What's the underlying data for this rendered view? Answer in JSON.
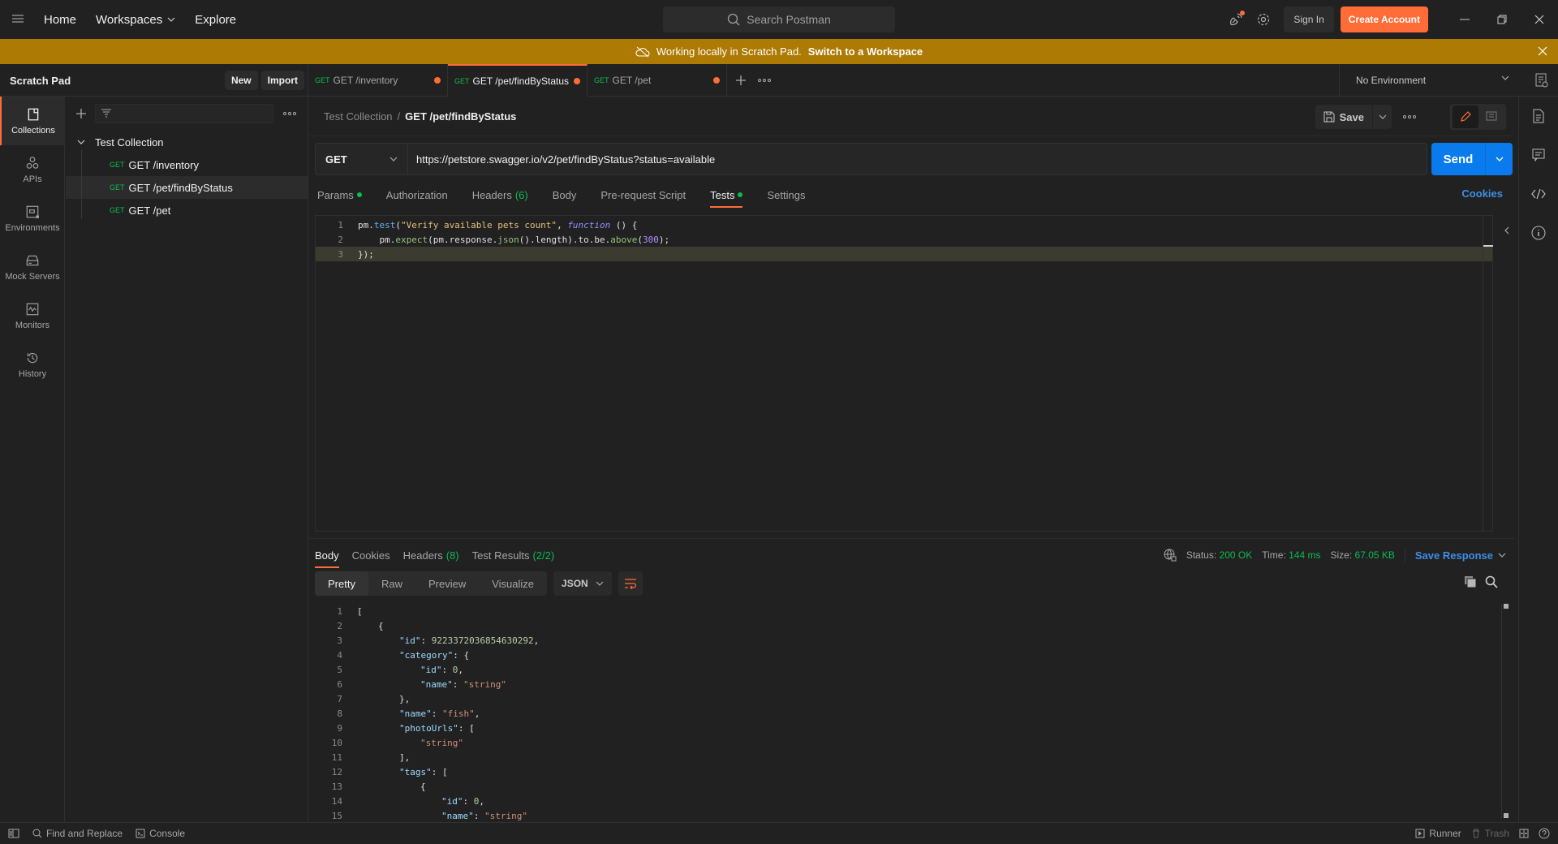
{
  "topbar": {
    "nav": {
      "home": "Home",
      "workspaces": "Workspaces",
      "explore": "Explore"
    },
    "search_placeholder": "Search Postman",
    "sign_in": "Sign In",
    "create_account": "Create Account"
  },
  "banner": {
    "text": "Working locally in Scratch Pad.",
    "link": "Switch to a Workspace"
  },
  "scratch": {
    "title": "Scratch Pad",
    "new": "New",
    "import": "Import"
  },
  "tabs": [
    {
      "method": "GET",
      "label": "GET /inventory",
      "unsaved": true,
      "active": false
    },
    {
      "method": "GET",
      "label": "GET /pet/findByStatus",
      "unsaved": true,
      "active": true
    },
    {
      "method": "GET",
      "label": "GET /pet",
      "unsaved": true,
      "active": false
    }
  ],
  "environment": {
    "selected": "No Environment"
  },
  "iconbar": [
    {
      "label": "Collections",
      "icon": "collections-icon",
      "active": true
    },
    {
      "label": "APIs",
      "icon": "apis-icon"
    },
    {
      "label": "Environments",
      "icon": "environments-icon"
    },
    {
      "label": "Mock Servers",
      "icon": "mock-servers-icon"
    },
    {
      "label": "Monitors",
      "icon": "monitors-icon"
    },
    {
      "label": "History",
      "icon": "history-icon"
    }
  ],
  "sidebar": {
    "collection": "Test Collection",
    "items": [
      {
        "method": "GET",
        "label": "GET /inventory"
      },
      {
        "method": "GET",
        "label": "GET /pet/findByStatus",
        "selected": true
      },
      {
        "method": "GET",
        "label": "GET /pet"
      }
    ]
  },
  "request": {
    "breadcrumb": {
      "parent": "Test Collection",
      "sep": "/",
      "current": "GET /pet/findByStatus"
    },
    "save": "Save",
    "method": "GET",
    "url": "https://petstore.swagger.io/v2/pet/findByStatus?status=available",
    "send": "Send",
    "tabs": [
      {
        "label": "Params",
        "dot": true
      },
      {
        "label": "Authorization"
      },
      {
        "label": "Headers",
        "count": "(6)"
      },
      {
        "label": "Body"
      },
      {
        "label": "Pre-request Script"
      },
      {
        "label": "Tests",
        "dot": true,
        "active": true
      },
      {
        "label": "Settings"
      }
    ],
    "cookies": "Cookies",
    "tests_code": [
      {
        "n": "1",
        "tokens": [
          [
            "",
            "pm."
          ],
          [
            "k-fn",
            "test"
          ],
          [
            "",
            "("
          ],
          [
            "k-str",
            "\"Verify available pets count\""
          ],
          [
            "",
            ", "
          ],
          [
            "k-kw",
            "function"
          ],
          [
            "",
            " () {"
          ]
        ]
      },
      {
        "n": "2",
        "tokens": [
          [
            "",
            "    pm."
          ],
          [
            "k-green",
            "expect"
          ],
          [
            "",
            "(pm.response."
          ],
          [
            "k-green",
            "json"
          ],
          [
            "",
            "().length).to.be."
          ],
          [
            "k-green",
            "above"
          ],
          [
            "",
            "("
          ],
          [
            "k-num",
            "300"
          ],
          [
            "",
            ");"
          ]
        ]
      },
      {
        "n": "3",
        "tokens": [
          [
            "",
            "});"
          ]
        ],
        "current": true
      }
    ]
  },
  "response": {
    "tabs": [
      {
        "label": "Body",
        "active": true
      },
      {
        "label": "Cookies"
      },
      {
        "label": "Headers",
        "count": "(8)"
      },
      {
        "label": "Test Results",
        "count": "(2/2)"
      }
    ],
    "status_label": "Status:",
    "status": "200 OK",
    "time_label": "Time:",
    "time": "144 ms",
    "size_label": "Size:",
    "size": "67.05 KB",
    "save_response": "Save Response",
    "views": [
      "Pretty",
      "Raw",
      "Preview",
      "Visualize"
    ],
    "active_view": "Pretty",
    "format": "JSON",
    "body_lines": [
      {
        "n": "1",
        "indent": 0,
        "tokens": [
          [
            "",
            "["
          ]
        ]
      },
      {
        "n": "2",
        "indent": 1,
        "tokens": [
          [
            "",
            "{"
          ]
        ]
      },
      {
        "n": "3",
        "indent": 2,
        "tokens": [
          [
            "j-key",
            "\"id\""
          ],
          [
            "",
            ": "
          ],
          [
            "j-num",
            "9223372036854630292"
          ],
          [
            "",
            ","
          ]
        ]
      },
      {
        "n": "4",
        "indent": 2,
        "tokens": [
          [
            "j-key",
            "\"category\""
          ],
          [
            "",
            ": {"
          ]
        ]
      },
      {
        "n": "5",
        "indent": 3,
        "tokens": [
          [
            "j-key",
            "\"id\""
          ],
          [
            "",
            ": "
          ],
          [
            "j-num",
            "0"
          ],
          [
            "",
            ","
          ]
        ]
      },
      {
        "n": "6",
        "indent": 3,
        "tokens": [
          [
            "j-key",
            "\"name\""
          ],
          [
            "",
            ": "
          ],
          [
            "j-str",
            "\"string\""
          ]
        ]
      },
      {
        "n": "7",
        "indent": 2,
        "tokens": [
          [
            "",
            "},"
          ]
        ]
      },
      {
        "n": "8",
        "indent": 2,
        "tokens": [
          [
            "j-key",
            "\"name\""
          ],
          [
            "",
            ": "
          ],
          [
            "j-str",
            "\"fish\""
          ],
          [
            "",
            ","
          ]
        ]
      },
      {
        "n": "9",
        "indent": 2,
        "tokens": [
          [
            "j-key",
            "\"photoUrls\""
          ],
          [
            "",
            ": ["
          ]
        ]
      },
      {
        "n": "10",
        "indent": 3,
        "tokens": [
          [
            "j-str",
            "\"string\""
          ]
        ]
      },
      {
        "n": "11",
        "indent": 2,
        "tokens": [
          [
            "",
            "],"
          ]
        ]
      },
      {
        "n": "12",
        "indent": 2,
        "tokens": [
          [
            "j-key",
            "\"tags\""
          ],
          [
            "",
            ": ["
          ]
        ]
      },
      {
        "n": "13",
        "indent": 3,
        "tokens": [
          [
            "",
            "{"
          ]
        ]
      },
      {
        "n": "14",
        "indent": 4,
        "tokens": [
          [
            "j-key",
            "\"id\""
          ],
          [
            "",
            ": "
          ],
          [
            "j-num",
            "0"
          ],
          [
            "",
            ","
          ]
        ]
      },
      {
        "n": "15",
        "indent": 4,
        "tokens": [
          [
            "j-key",
            "\"name\""
          ],
          [
            "",
            ": "
          ],
          [
            "j-str",
            "\"string\""
          ]
        ]
      }
    ]
  },
  "statusbar": {
    "find_replace": "Find and Replace",
    "console": "Console",
    "runner": "Runner",
    "trash": "Trash"
  }
}
